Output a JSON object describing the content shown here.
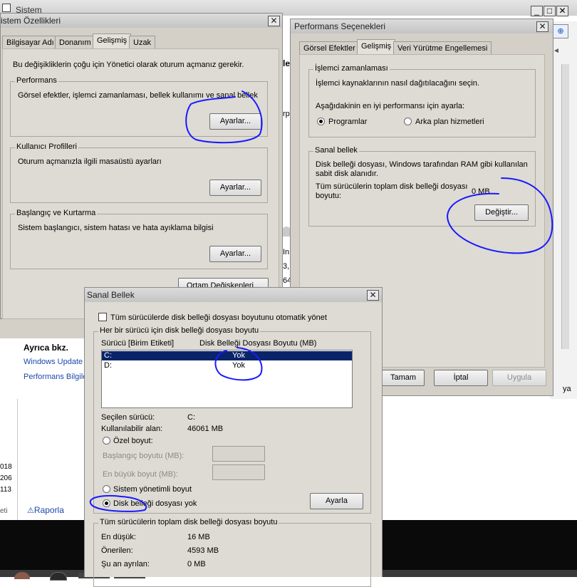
{
  "bg": {
    "system_title": "Sistem",
    "see_also": "Ayrıca bkz.",
    "windows_update": "Windows Update",
    "perf_info": "Performans Bilgile",
    "fragments": [
      "ler",
      "rp",
      "In",
      "3,",
      "64"
    ],
    "numbers": [
      "018",
      "206",
      "113"
    ],
    "eti": "eti",
    "report": "Raporla",
    "ya": "ya"
  },
  "sysprops": {
    "title": "istem Özellikleri",
    "tabs": [
      "Bilgisayar Adı",
      "Donanım",
      "Gelişmiş",
      "Uzak"
    ],
    "admin_note": "Bu değişikliklerin çoğu için Yönetici olarak oturum açmanız gerekir.",
    "performance": {
      "label": "Performans",
      "desc": "Görsel efektler, işlemci zamanlaması, bellek kullanımı ve sanal bellek",
      "button": "Ayarlar..."
    },
    "profiles": {
      "label": "Kullanıcı Profilleri",
      "desc": "Oturum açmanızla ilgili masaüstü ayarları",
      "button": "Ayarlar..."
    },
    "startup": {
      "label": "Başlangıç ve Kurtarma",
      "desc": "Sistem başlangıcı, sistem hatası ve hata ayıklama bilgisi",
      "button": "Ayarlar..."
    },
    "env_button": "Ortam Değişkenleri..."
  },
  "perfopts": {
    "title": "Performans Seçenekleri",
    "tabs": [
      "Görsel Efektler",
      "Gelişmiş",
      "Veri Yürütme Engellemesi"
    ],
    "scheduling": {
      "label": "İşlemci zamanlaması",
      "desc": "İşlemci kaynaklarının nasıl dağıtılacağını seçin.",
      "prompt": "Aşağıdakinin en iyi performansı için ayarla:",
      "opt_programs": "Programlar",
      "opt_background": "Arka plan hizmetleri"
    },
    "vm": {
      "label": "Sanal bellek",
      "desc1": "Disk belleği dosyası, Windows tarafından RAM gibi kullanılan",
      "desc2": "sabit disk alanıdır.",
      "total1": "Tüm sürücülerin toplam disk belleği dosyası",
      "total2": "boyutu:",
      "total_value": "0 MB",
      "button": "Değiştir..."
    },
    "ok": "Tamam",
    "cancel": "İptal",
    "apply": "Uygula"
  },
  "virtmem": {
    "title": "Sanal Bellek",
    "auto_manage": "Tüm sürücülerde disk belleği dosyası boyutunu otomatik yönet",
    "per_drive_label": "Her bir sürücü için disk belleği dosyası boyutu",
    "col_drive": "Sürücü  [Birim Etiketi]",
    "col_size": "Disk Belleği Dosyası Boyutu (MB)",
    "drives": [
      {
        "drive": "C:",
        "size": "Yok"
      },
      {
        "drive": "D:",
        "size": "Yok"
      }
    ],
    "selected_drive_label": "Seçilen sürücü:",
    "selected_drive_value": "C:",
    "available_label": "Kullanılabilir alan:",
    "available_value": "46061 MB",
    "custom_size": "Özel boyut:",
    "initial_size": "Başlangıç boyutu (MB):",
    "max_size": "En büyük boyut (MB):",
    "system_managed": "Sistem yönetimli boyut",
    "no_paging": "Disk belleği dosyası yok",
    "set_button": "Ayarla",
    "total_label": "Tüm sürücülerin toplam disk belleği dosyası boyutu",
    "min_label": "En düşük:",
    "min_value": "16 MB",
    "recommended_label": "Önerilen:",
    "recommended_value": "4593 MB",
    "allocated_label": "Şu an ayrılan:",
    "allocated_value": "0 MB"
  },
  "colors": {
    "annotation_ink": "#1a1aff",
    "selection": "#0a246a",
    "dialog_face": "#d4d0c8",
    "taskbar": "#0a0a0a"
  }
}
